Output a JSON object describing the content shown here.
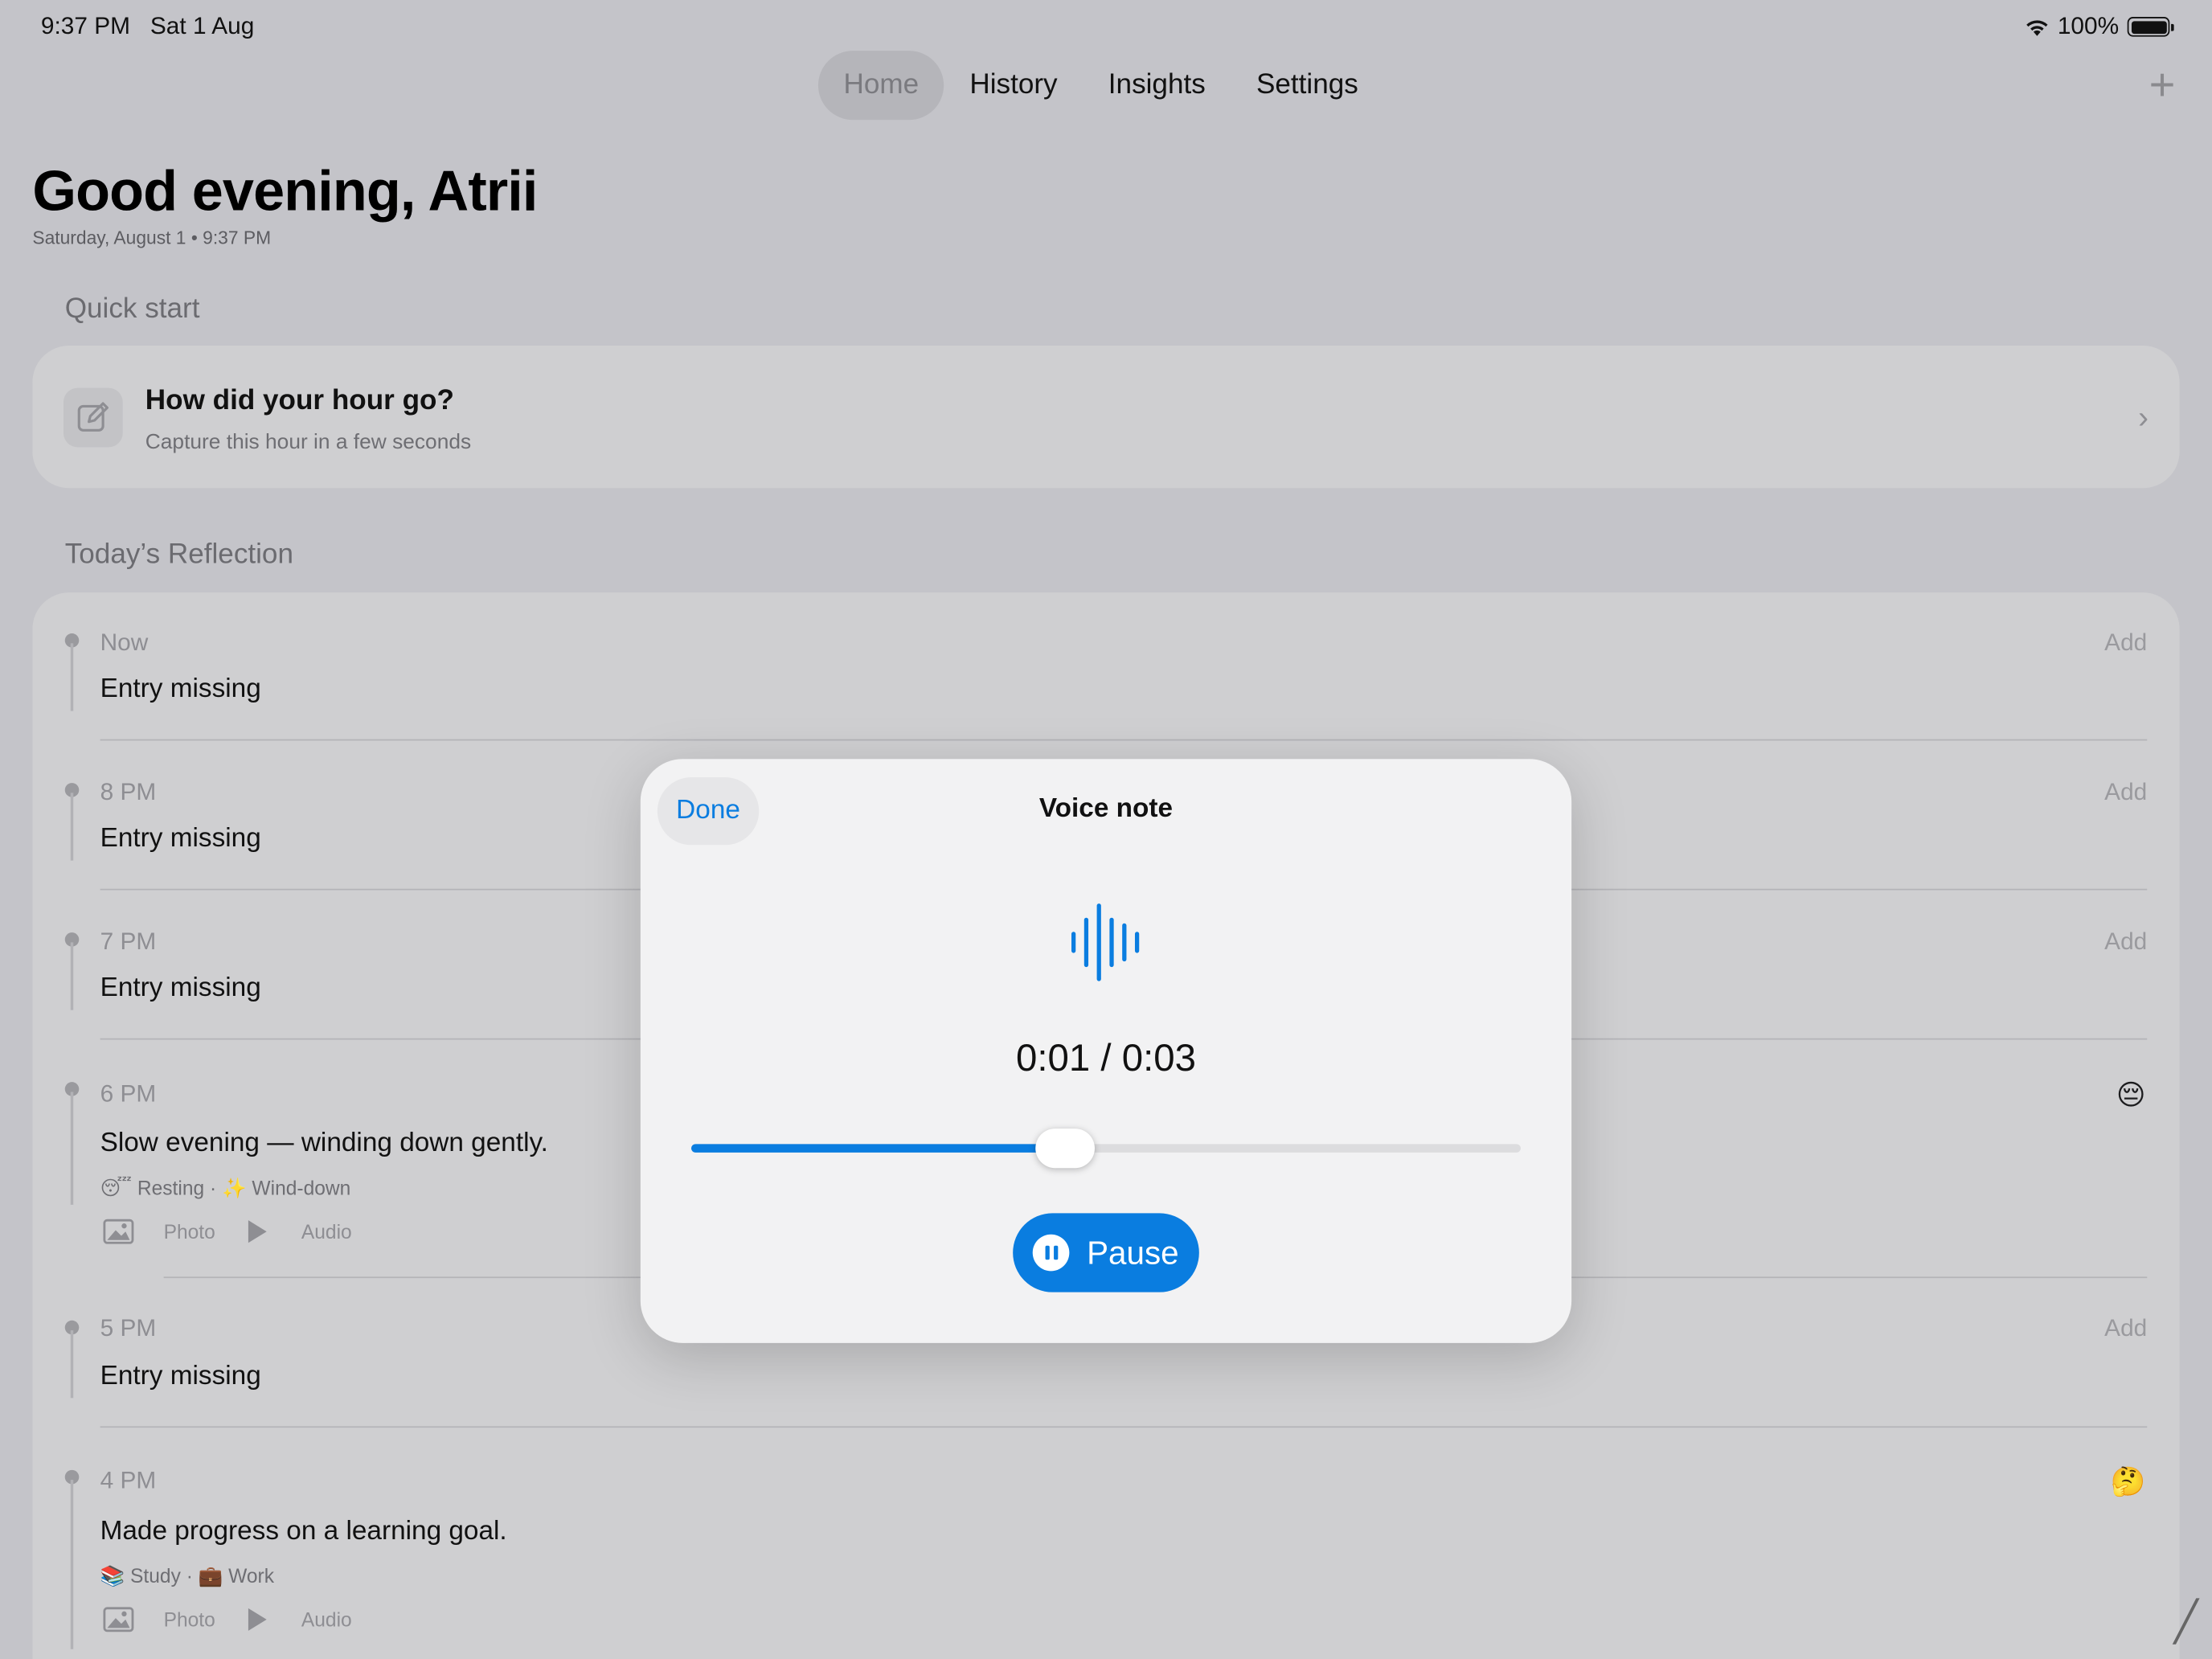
{
  "status_bar": {
    "time": "9:37 PM",
    "date": "Sat 1 Aug",
    "battery": "100%"
  },
  "tabs": [
    {
      "label": "Home",
      "active": true
    },
    {
      "label": "History",
      "active": false
    },
    {
      "label": "Insights",
      "active": false
    },
    {
      "label": "Settings",
      "active": false
    }
  ],
  "header": {
    "greeting": "Good evening, Atrii",
    "dateline": "Saturday, August 1 • 9:37 PM"
  },
  "quick_start": {
    "section_title": "Quick start",
    "title": "How did your hour go?",
    "subtitle": "Capture this hour in a few seconds"
  },
  "reflection": {
    "section_title": "Today’s Reflection",
    "entries": [
      {
        "time": "Now",
        "text": "Entry missing",
        "add": "Add"
      },
      {
        "time": "8 PM",
        "text": "Entry missing",
        "add": "Add"
      },
      {
        "time": "7 PM",
        "text": "Entry missing",
        "add": "Add"
      },
      {
        "time": "6 PM",
        "text": "Slow evening — winding down gently.",
        "tags": "😴 Resting · ✨ Wind-down",
        "photo": "Photo",
        "audio": "Audio",
        "emoji": "😔"
      },
      {
        "time": "5 PM",
        "text": "Entry missing",
        "add": "Add"
      },
      {
        "time": "4 PM",
        "text": "Made progress on a learning goal.",
        "tags": "📚 Study · 💼 Work",
        "photo": "Photo",
        "audio": "Audio",
        "emoji": "🤔"
      }
    ]
  },
  "voice_note": {
    "done": "Done",
    "title": "Voice note",
    "time": "0:01 / 0:03",
    "progress_fraction": 0.45,
    "pause": "Pause"
  },
  "colors": {
    "accent": "#0a7de0",
    "background": "#c4c4c9",
    "card": "#cfcfd1"
  }
}
